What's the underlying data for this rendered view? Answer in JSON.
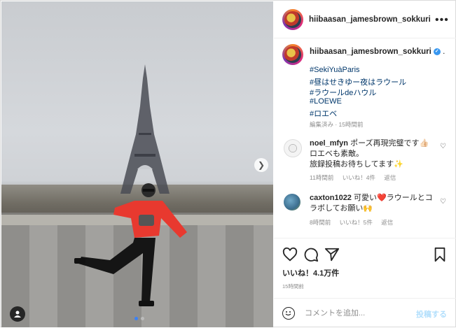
{
  "post": {
    "username": "hiibaasan_jamesbrown_sokkuri",
    "caption_suffix": ".",
    "hashtags": [
      "#SekiYuàParis",
      "#昼はせきゆー夜はラウール",
      "#ラウールdeハウル",
      "#LOEWE",
      "#ロエベ"
    ],
    "caption_meta": "編集済み · 15時間前"
  },
  "comments": [
    {
      "user": "noel_mfyn",
      "text_line1": "ポーズ再現完璧です👍🏻",
      "text_line2": "ロエベも素敵。",
      "text_line3": "旅録投稿お待ちしてます✨",
      "time": "11時間前",
      "likes": "いいね！4件",
      "reply": "返信"
    },
    {
      "user": "caxton1022",
      "text_line1": "可愛い❤️ラウールとコ",
      "text_line2": "ラボしてお願い🙌",
      "time": "8時間前",
      "likes": "いいね！5件",
      "reply": "返信"
    }
  ],
  "likes_text": "いいね！4.1万件",
  "post_time": "15時間前",
  "comment_placeholder": "コメントを追加...",
  "post_button": "投稿する",
  "icons": {
    "more": "more-horizontal-icon",
    "like": "heart-icon",
    "comment": "comment-icon",
    "share": "share-icon",
    "save": "bookmark-icon",
    "emoji": "emoji-icon",
    "next": "chevron-right-icon",
    "user_tag": "user-tag-icon"
  },
  "colors": {
    "hashtag": "#00376b",
    "verified": "#3897f0",
    "post_button": "#b2dffc"
  },
  "carousel": {
    "count": 2,
    "active": 1
  }
}
